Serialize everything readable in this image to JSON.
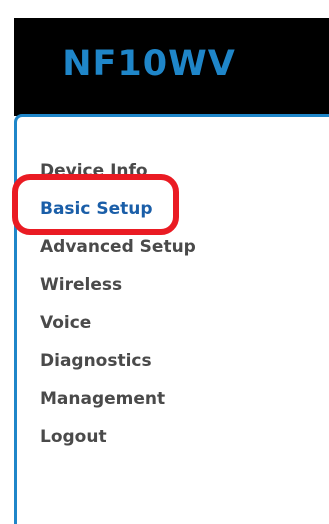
{
  "header": {
    "brand": "NF10WV",
    "brand_color": "#1f86c9",
    "background_color": "#000000"
  },
  "menu": {
    "active_index": 1,
    "items": [
      {
        "label": "Device Info"
      },
      {
        "label": "Basic Setup"
      },
      {
        "label": "Advanced Setup"
      },
      {
        "label": "Wireless"
      },
      {
        "label": "Voice"
      },
      {
        "label": "Diagnostics"
      },
      {
        "label": "Management"
      },
      {
        "label": "Logout"
      }
    ]
  },
  "annotation": {
    "highlight_color": "#ea1b23"
  }
}
